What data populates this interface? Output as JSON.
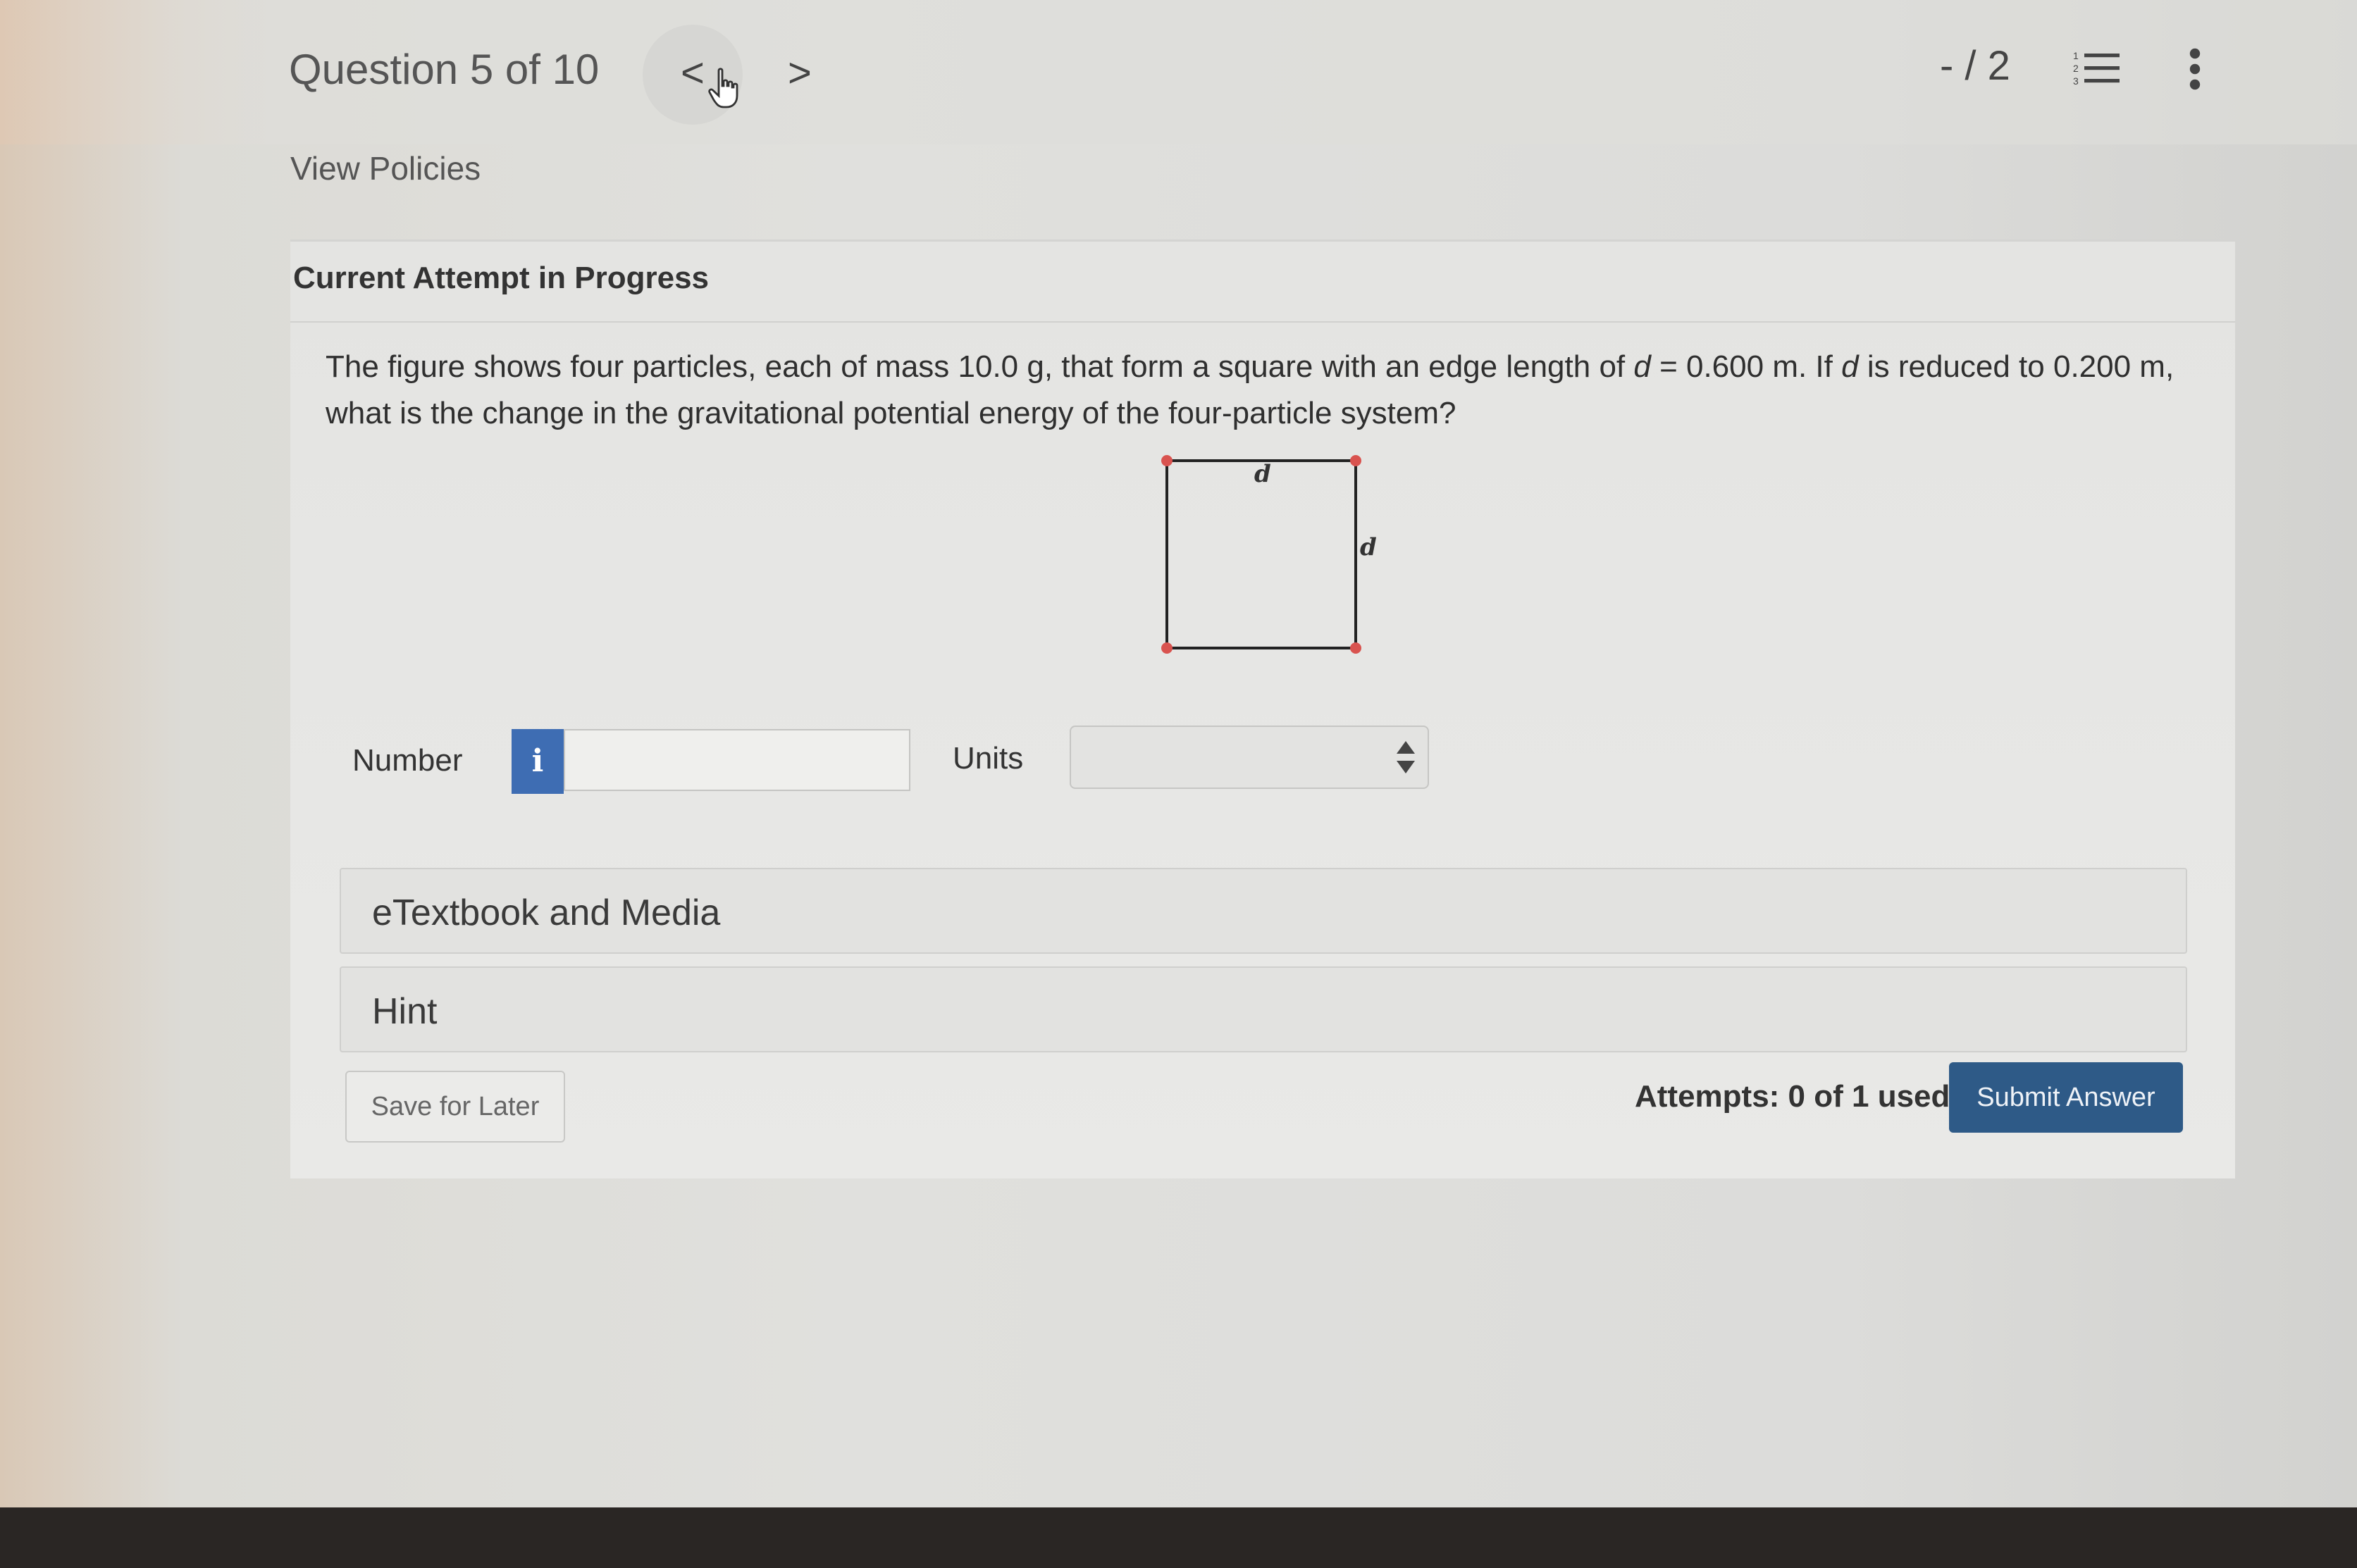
{
  "header": {
    "question_counter": "Question 5 of 10",
    "prev_icon": "chevron-left-icon",
    "prev_glyph": "<",
    "next_icon": "chevron-right-icon",
    "next_glyph": ">",
    "score": "- / 2",
    "list_icon": "list-icon",
    "more_icon": "more-vertical-icon"
  },
  "links": {
    "view_policies": "View Policies"
  },
  "attempt": {
    "heading": "Current Attempt in Progress"
  },
  "question": {
    "text_part1": "The figure shows four particles, each of mass 10.0 g, that form a square with an edge length of ",
    "var1": "d",
    "text_part2": " = 0.600 m. If ",
    "var2": "d",
    "text_part3": " is reduced to 0.200 m, what is the change in the gravitational potential energy of the four-particle system?"
  },
  "figure": {
    "top_label": "d",
    "side_label": "d",
    "particle_color": "#d9534f"
  },
  "answer": {
    "number_label": "Number",
    "info_glyph": "i",
    "number_value": "",
    "units_label": "Units",
    "units_selected": ""
  },
  "accordions": {
    "etextbook": "eTextbook and Media",
    "hint": "Hint"
  },
  "footer": {
    "save_label": "Save for Later",
    "attempts_text": "Attempts: 0 of 1 used",
    "submit_label": "Submit Answer"
  },
  "colors": {
    "primary_button": "#2e5a87",
    "info_button": "#3e6db3"
  }
}
